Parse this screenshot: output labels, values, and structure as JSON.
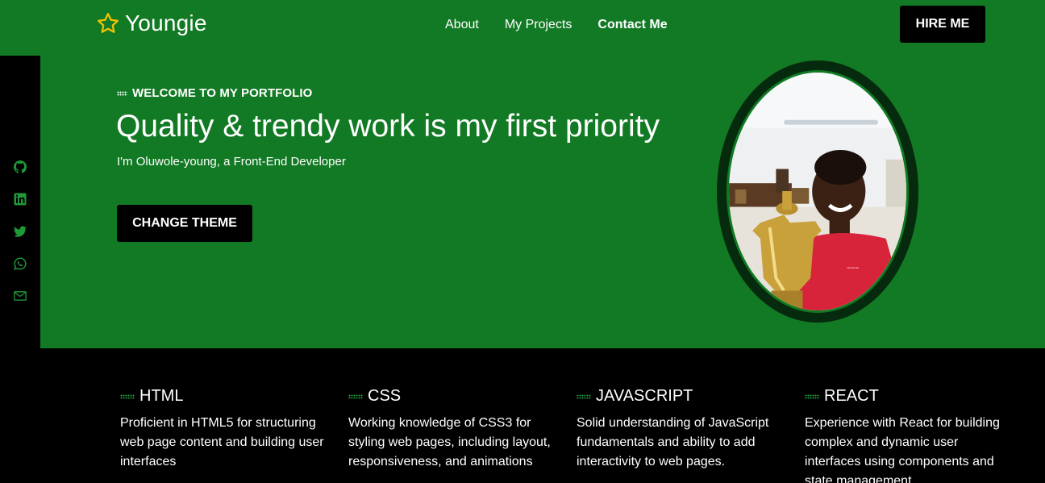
{
  "header": {
    "brand": "Youngie",
    "nav": [
      {
        "label": "About"
      },
      {
        "label": "My Projects"
      },
      {
        "label": "Contact Me"
      }
    ],
    "hire_label": "HIRE ME"
  },
  "sidebar": {
    "icons": [
      "github-icon",
      "linkedin-icon",
      "twitter-icon",
      "whatsapp-icon",
      "mail-icon"
    ]
  },
  "hero": {
    "eyebrow": "WELCOME TO MY PORTFOLIO",
    "headline": "Quality & trendy work is my first priority",
    "subline": "I'm Oluwole-young, a Front-End Developer",
    "theme_button": "CHANGE THEME"
  },
  "skills": [
    {
      "title": "HTML",
      "desc": "Proficient in HTML5 for structuring web page content and building user interfaces"
    },
    {
      "title": "CSS",
      "desc": "Working knowledge of CSS3 for styling web pages, including layout, responsiveness, and animations"
    },
    {
      "title": "JAVASCRIPT",
      "desc": "Solid understanding of JavaScript fundamentals and ability to add interactivity to web pages."
    },
    {
      "title": "REACT",
      "desc": "Experience with React for building complex and dynamic user interfaces using components and state management"
    }
  ],
  "colors": {
    "primary_green": "#127a24",
    "accent_green": "#1e9a38",
    "star": "#f2c200",
    "dark": "#000000"
  }
}
